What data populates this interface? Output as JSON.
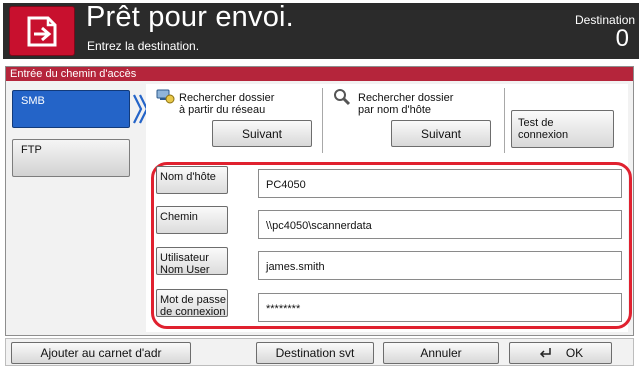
{
  "header": {
    "title": "Prêt pour envoi.",
    "subtitle": "Entrez la destination.",
    "destination_label": "Destination",
    "destination_count": "0",
    "home_icon": "home-icon"
  },
  "panel": {
    "title": "Entrée du chemin d'accès",
    "tabs": [
      {
        "label": "SMB",
        "selected": true
      },
      {
        "label": "FTP",
        "selected": false
      }
    ],
    "search_network": {
      "line1": "Rechercher dossier",
      "line2": "à partir du réseau",
      "button": "Suivant"
    },
    "search_host": {
      "line1": "Rechercher dossier",
      "line2": "par nom d'hôte",
      "button": "Suivant"
    },
    "test_connection": {
      "line1": "Test de",
      "line2": "connexion"
    },
    "fields": [
      {
        "label_line1": "Nom d'hôte",
        "label_line2": "",
        "value": "PC4050"
      },
      {
        "label_line1": "Chemin",
        "label_line2": "",
        "value": "\\\\pc4050\\scannerdata"
      },
      {
        "label_line1": "Utilisateur",
        "label_line2": "Nom User",
        "value": "james.smith"
      },
      {
        "label_line1": "Mot de passe",
        "label_line2": "de connexion",
        "value": "********"
      }
    ],
    "highlight_color": "#e0212f"
  },
  "footer": {
    "add_to_book": "Ajouter au carnet d'adr",
    "next_destination": "Destination svt",
    "cancel": "Annuler",
    "ok": "OK"
  },
  "colors": {
    "header_bg": "#2b2b2b",
    "home_button": "#c8102e",
    "panel_title": "#b5253b",
    "selected_tab": "#2464c8"
  }
}
